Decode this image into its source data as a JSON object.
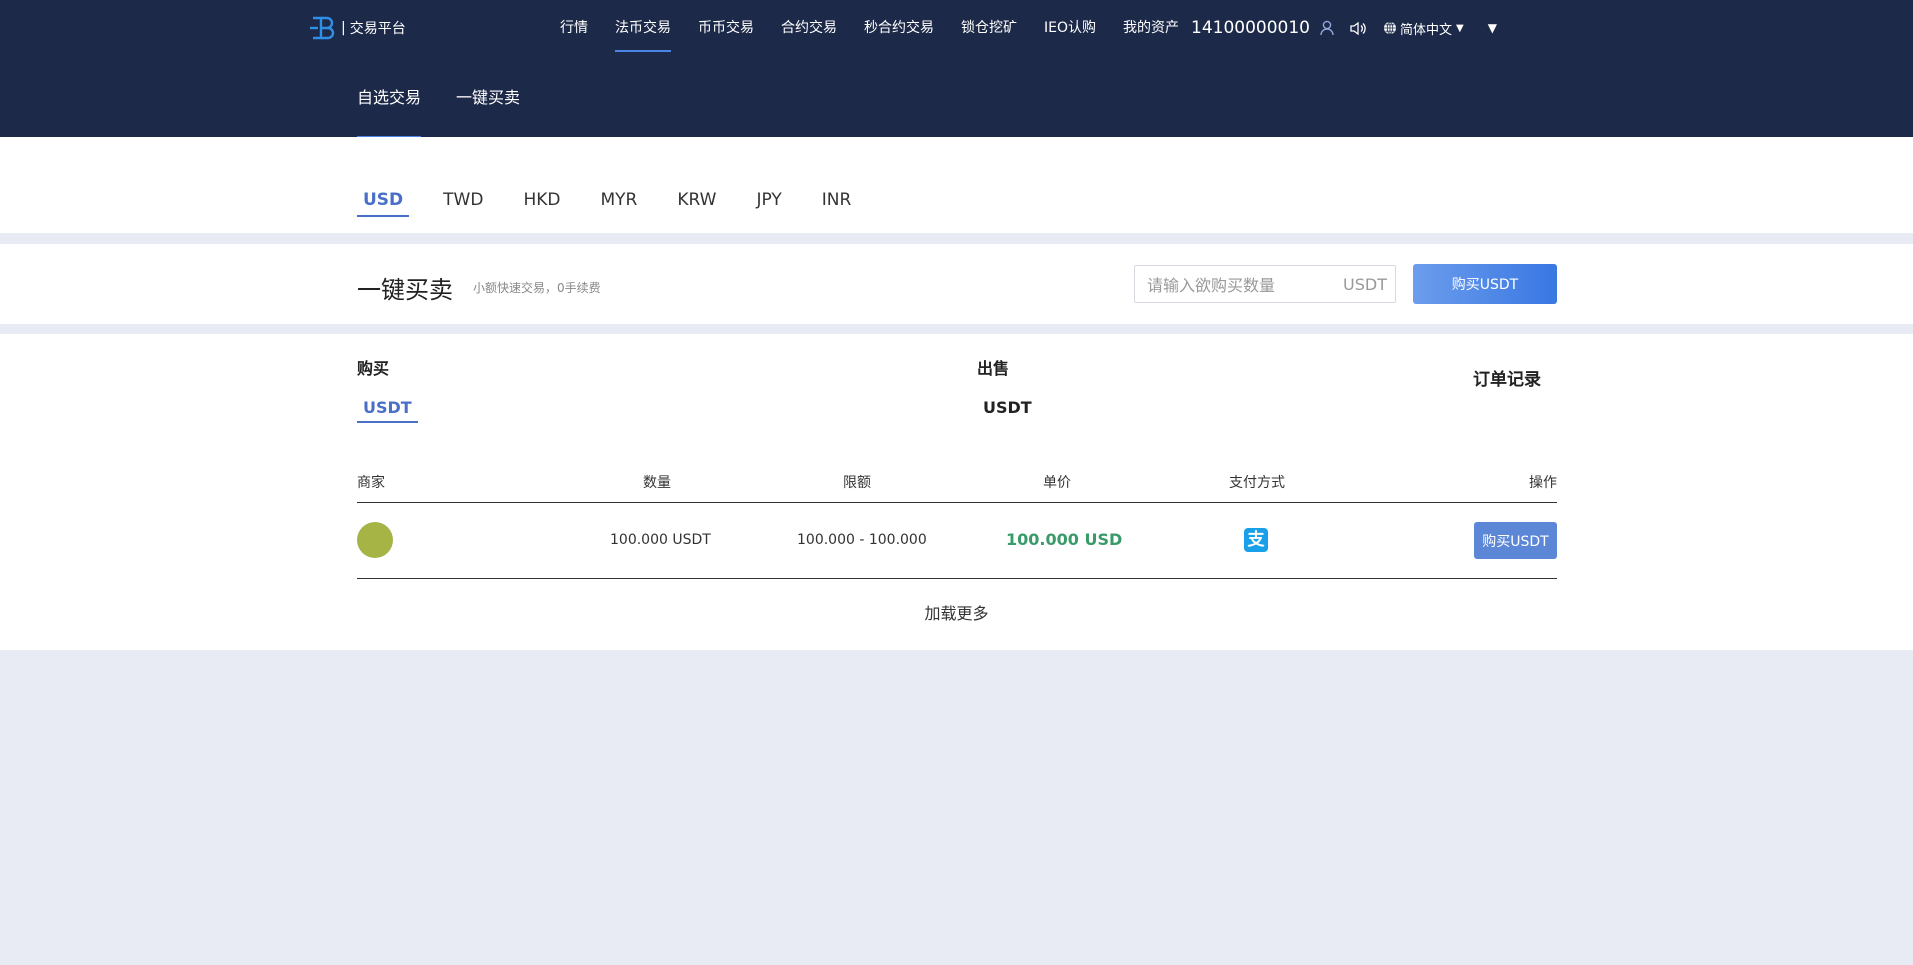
{
  "header": {
    "logo_text": "交易平台",
    "logo_sep": "|",
    "nav": [
      {
        "label": "行情"
      },
      {
        "label": "法币交易"
      },
      {
        "label": "币币交易"
      },
      {
        "label": "合约交易"
      },
      {
        "label": "秒合约交易"
      },
      {
        "label": "锁仓挖矿"
      },
      {
        "label": "IEO认购"
      },
      {
        "label": "我的资产"
      }
    ],
    "active_nav": "法币交易",
    "user_phone": "14100000010",
    "language": "简体中文",
    "subtabs": [
      {
        "label": "自选交易"
      },
      {
        "label": "一键买卖"
      }
    ],
    "active_subtab": "自选交易"
  },
  "currencies": [
    "USD",
    "TWD",
    "HKD",
    "MYR",
    "KRW",
    "JPY",
    "INR"
  ],
  "active_currency": "USD",
  "quick_trade": {
    "title": "一键买卖",
    "subtitle": "小额快速交易，0手续费",
    "input_placeholder": "请输入欲购买数量",
    "unit": "USDT",
    "button_label": "购买USDT"
  },
  "market": {
    "buy_label": "购买",
    "sell_label": "出售",
    "buy_coin": "USDT",
    "sell_coin": "USDT",
    "orders_label": "订单记录",
    "columns": [
      "商家",
      "数量",
      "限额",
      "单价",
      "支付方式",
      "操作"
    ],
    "rows": [
      {
        "amount": "100.000 USDT",
        "limit": "100.000 - 100.000",
        "price": "100.000 USD",
        "payment_icon": "alipay-icon",
        "payment_glyph": "支",
        "action": "购买USDT"
      }
    ],
    "load_more": "加载更多"
  },
  "colors": {
    "header_bg": "#1d2948",
    "accent": "#4a84e6",
    "price_green": "#3a9b6a",
    "page_bg": "#e8ebf3",
    "alipay_blue": "#1aa0e8",
    "avatar": "#a5b445"
  }
}
